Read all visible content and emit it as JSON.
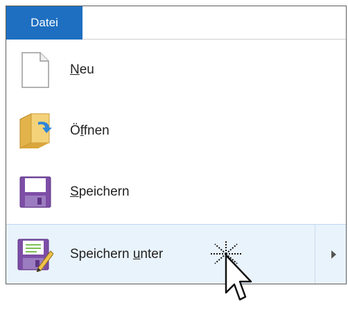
{
  "ribbon": {
    "file_tab": "Datei"
  },
  "menu": {
    "items": [
      {
        "pre": "",
        "key": "N",
        "post": "eu",
        "icon": "new-document-icon"
      },
      {
        "pre": "Ö",
        "key": "f",
        "post": "fnen",
        "icon": "open-folder-icon"
      },
      {
        "pre": "",
        "key": "S",
        "post": "peichern",
        "icon": "save-floppy-icon"
      },
      {
        "pre": "Speichern ",
        "key": "u",
        "post": "nter",
        "icon": "save-as-icon",
        "has_submenu": true,
        "hovered": true
      }
    ]
  },
  "colors": {
    "accent": "#1e6fc1",
    "hover_bg": "#e9f3fc",
    "floppy": "#7d4ea6"
  }
}
